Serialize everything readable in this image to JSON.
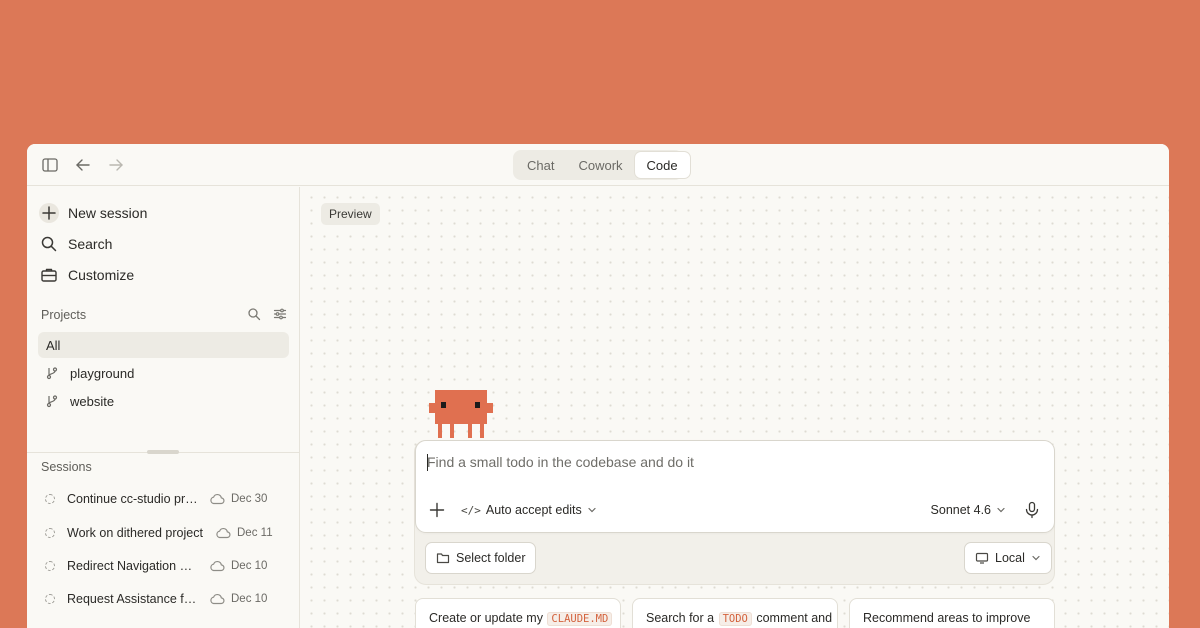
{
  "titlebar": {
    "icons": [
      "sidebar-toggle-icon",
      "back-arrow-icon",
      "forward-arrow-icon"
    ],
    "modes": [
      {
        "label": "Chat",
        "active": false
      },
      {
        "label": "Cowork",
        "active": false
      },
      {
        "label": "Code",
        "active": true
      }
    ]
  },
  "sidebar": {
    "nav": [
      {
        "label": "New session",
        "icon": "plus-icon"
      },
      {
        "label": "Search",
        "icon": "search-icon"
      },
      {
        "label": "Customize",
        "icon": "briefcase-icon"
      }
    ],
    "projects_label": "Projects",
    "projects_all": "All",
    "projects": [
      {
        "label": "playground",
        "icon": "branch-icon"
      },
      {
        "label": "website",
        "icon": "branch-icon"
      }
    ],
    "sessions_label": "Sessions",
    "sessions": [
      {
        "title": "Continue cc-studio project",
        "date": "Dec 30"
      },
      {
        "title": "Work on dithered project",
        "date": "Dec 11"
      },
      {
        "title": "Redirect Navigation and Routing",
        "date": "Dec 10"
      },
      {
        "title": "Request Assistance for Task",
        "date": "Dec 10"
      }
    ]
  },
  "main": {
    "preview_label": "Preview",
    "composer": {
      "placeholder": "Find a small todo in the codebase and do it",
      "auto_accept_label": "Auto accept edits",
      "model_label": "Sonnet 4.6"
    },
    "select_folder_label": "Select folder",
    "environment_label": "Local",
    "suggestions": [
      {
        "before": "Create or update my ",
        "code": "CLAUDE.MD",
        "after": ""
      },
      {
        "before": "Search for a ",
        "code": "TODO",
        "after": " comment and"
      },
      {
        "before": "Recommend areas to improve",
        "code": "",
        "after": ""
      }
    ]
  },
  "colors": {
    "background": "#DC7857",
    "accent": "#E07050",
    "surface": "#FAF9F5"
  }
}
